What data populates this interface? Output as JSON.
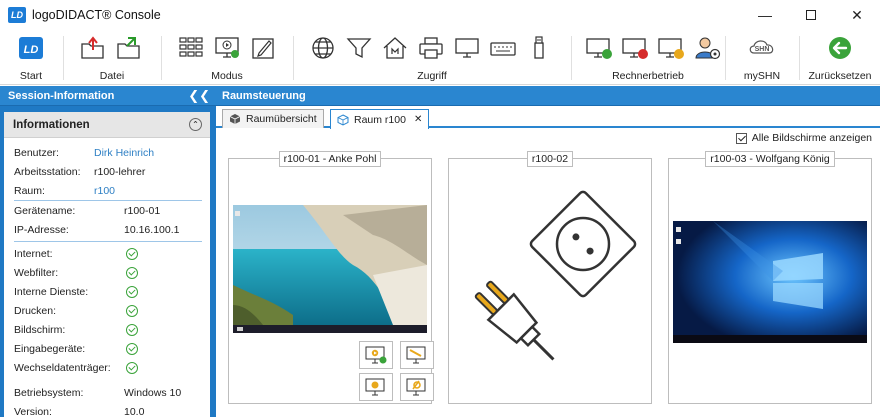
{
  "window": {
    "title": "logoDIDACT® Console",
    "logo_text": "LD"
  },
  "ribbon": {
    "groups": {
      "start": "Start",
      "datei": "Datei",
      "modus": "Modus",
      "zugriff": "Zugriff",
      "rechnerbetrieb": "Rechnerbetrieb",
      "myshn": "mySHN",
      "zuruecksetzen": "Zurücksetzen"
    },
    "shn_icon_text": "SHN",
    "icons": [
      "start-logo-icon",
      "open-folder-icon",
      "save-folder-icon",
      "room-layout-icon",
      "presentation-icon",
      "edit-icon",
      "globe-icon",
      "filter-icon",
      "home-network-icon",
      "printer-icon",
      "monitor-icon",
      "keyboard-icon",
      "usb-icon",
      "computer-on-icon",
      "computer-off-icon",
      "computer-restart-icon",
      "user-settings-icon",
      "myshn-icon",
      "reset-icon"
    ]
  },
  "left_panel": {
    "header": "Session-Information",
    "info_title": "Informationen",
    "user": {
      "label": "Benutzer:",
      "value": "Dirk Heinrich"
    },
    "workstation": {
      "label": "Arbeitsstation:",
      "value": "r100-lehrer"
    },
    "room": {
      "label": "Raum:",
      "value": "r100"
    },
    "device": {
      "label": "Gerätename:",
      "value": "r100-01"
    },
    "ip": {
      "label": "IP-Adresse:",
      "value": "10.16.100.1"
    },
    "status": [
      {
        "label": "Internet:"
      },
      {
        "label": "Webfilter:"
      },
      {
        "label": "Interne Dienste:"
      },
      {
        "label": "Drucken:"
      },
      {
        "label": "Bildschirm:"
      },
      {
        "label": "Eingabegeräte:"
      },
      {
        "label": "Wechseldatenträger:"
      }
    ],
    "os": {
      "label": "Betriebsystem:",
      "value": "Windows 10"
    },
    "version": {
      "label": "Version:",
      "value": "10.0"
    }
  },
  "main": {
    "header": "Raumsteuerung",
    "tabs": [
      {
        "label": "Raumübersicht"
      },
      {
        "label": "Raum r100",
        "close": "✕"
      }
    ],
    "show_all_label": "Alle Bildschirme anzeigen",
    "cards": [
      {
        "title": "r100-01 - Anke Pohl",
        "state": "screenshot-beach"
      },
      {
        "title": "r100-02",
        "state": "powered-off"
      },
      {
        "title": "r100-03 - Wolfgang König",
        "state": "screenshot-windows"
      }
    ]
  },
  "colors": {
    "accent": "#2a86d0",
    "status_ok": "#3aa33a",
    "link": "#2d7fc4"
  }
}
